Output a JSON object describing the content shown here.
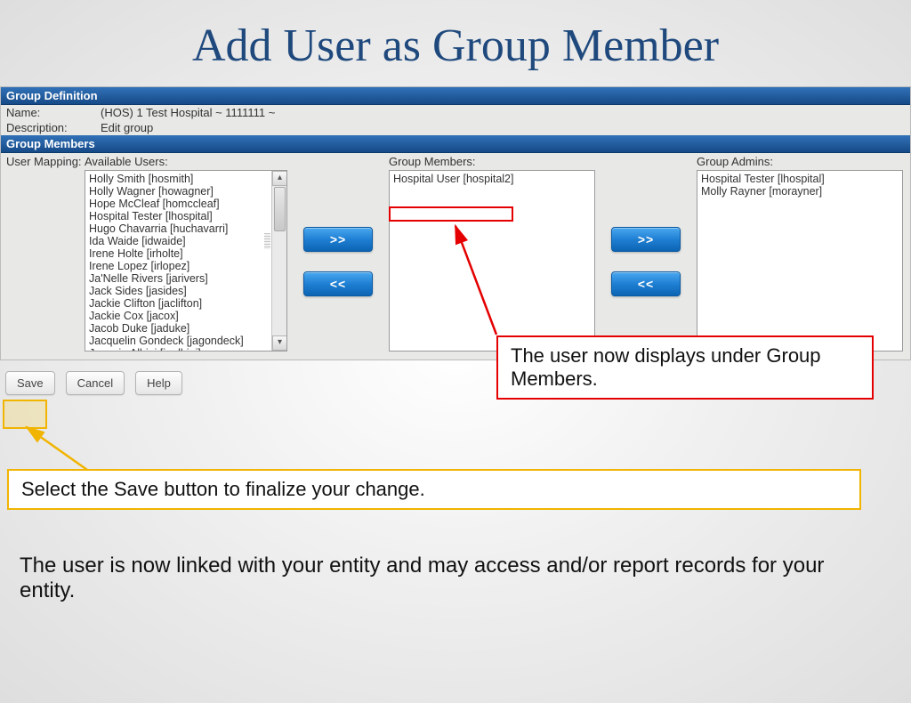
{
  "title": "Add User as Group Member",
  "sections": {
    "definition_header": "Group Definition",
    "members_header": "Group Members"
  },
  "definition": {
    "name_label": "Name:",
    "name_value": "(HOS) 1 Test Hospital ~ 1111111 ~",
    "desc_label": "Description:",
    "desc_value": "Edit group"
  },
  "mapping": {
    "row_label": "User Mapping:",
    "available_caption": "Available Users:",
    "members_caption": "Group Members:",
    "admins_caption": "Group Admins:",
    "available_users": [
      "Holly Smith [hosmith]",
      "Holly Wagner [howagner]",
      "Hope McCleaf [homccleaf]",
      "Hospital Tester [lhospital]",
      "Hugo Chavarria [huchavarri]",
      "Ida Waide [idwaide]",
      "Irene Holte [irholte]",
      "Irene Lopez [irlopez]",
      "Ja'Nelle Rivers [jarivers]",
      "Jack Sides [jasides]",
      "Jackie Clifton [jaclifton]",
      "Jackie Cox [jacox]",
      "Jacob Duke [jaduke]",
      "Jacquelin Gondeck [jagondeck]",
      "Jacquie Albini [jaalbini]"
    ],
    "group_members": [
      "Hospital User [hospital2]"
    ],
    "group_admins": [
      "Hospital Tester [lhospital]",
      "Molly Rayner [morayner]"
    ],
    "add_label": ">>",
    "remove_label": "<<"
  },
  "actions": {
    "save": "Save",
    "cancel": "Cancel",
    "help": "Help"
  },
  "callouts": {
    "red_text": "The user now displays under Group Members.",
    "amber_text": "Select the Save button to finalize your change.",
    "footer_text": "The user is now linked with your entity and may access and/or report records for your entity."
  }
}
